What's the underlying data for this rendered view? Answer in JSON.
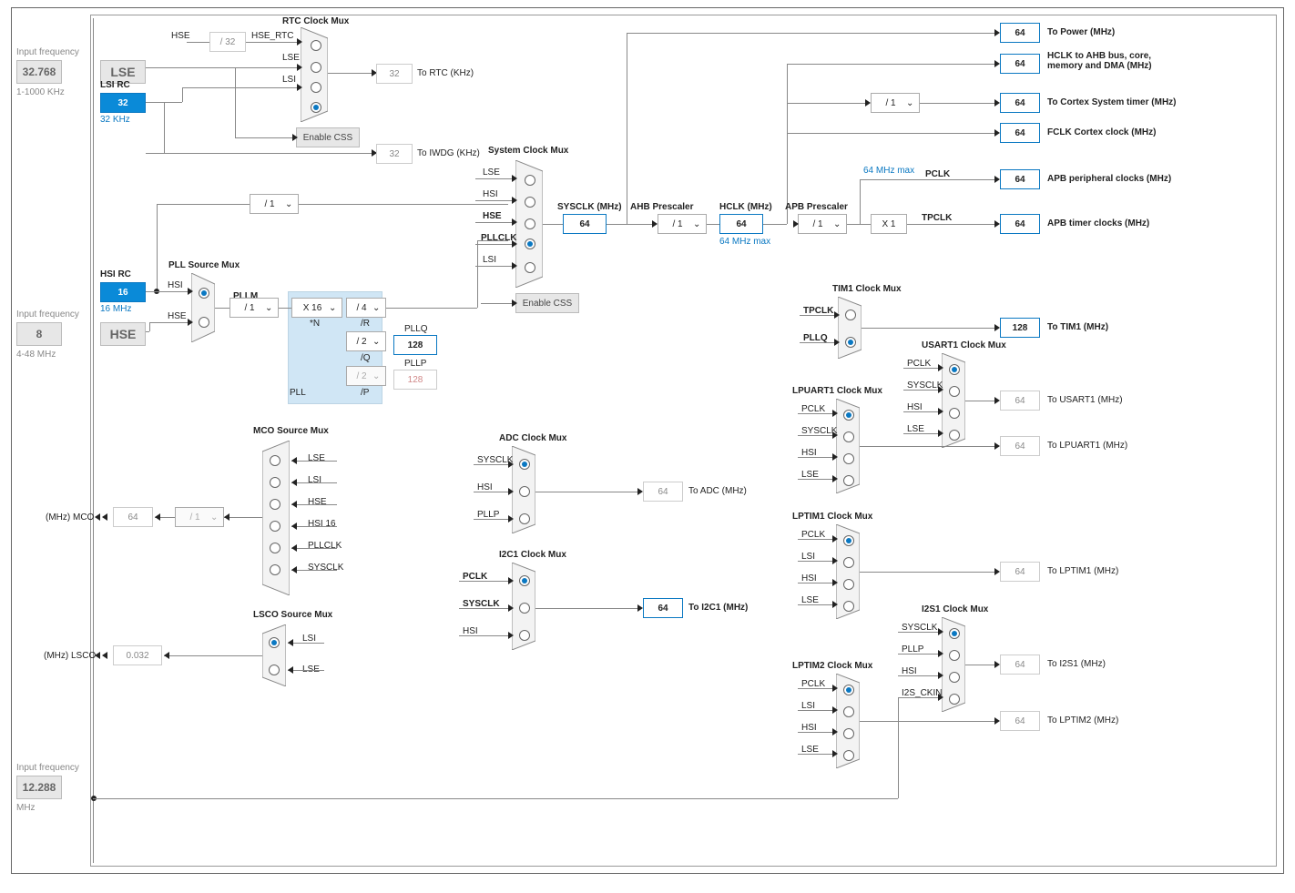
{
  "left": {
    "lse": {
      "label": "Input frequency",
      "val": "32.768",
      "range": "1-1000 KHz"
    },
    "hse": {
      "label": "Input frequency",
      "val": "8",
      "range": "4-48 MHz"
    },
    "i2s": {
      "label": "Input frequency",
      "val": "12.288",
      "unit": "MHz"
    }
  },
  "osc": {
    "lse": {
      "label": "LSE"
    },
    "lsi": {
      "title": "LSI RC",
      "val": "32",
      "unit": "32 KHz"
    },
    "hsi": {
      "title": "HSI RC",
      "val": "16",
      "unit": "16 MHz"
    },
    "hse": {
      "label": "HSE"
    }
  },
  "rtc": {
    "title": "RTC Clock Mux",
    "hse_rtc_label": "HSE_RTC",
    "hse_div": "/ 32",
    "hse": "HSE",
    "lse": "LSE",
    "lsi": "LSI",
    "enable": "Enable CSS",
    "val": "32",
    "out": "To RTC (KHz)"
  },
  "iwdg": {
    "val": "32",
    "out": "To IWDG (KHz)"
  },
  "hsidiv": {
    "val": "/ 1"
  },
  "pllsrc": {
    "title": "PLL Source Mux",
    "hsi": "HSI",
    "hse": "HSE"
  },
  "pll": {
    "pllm": "/ 1",
    "n": "X 16",
    "n_lbl": "*N",
    "r": "/ 4",
    "r_lbl": "/R",
    "q": "/ 2",
    "q_lbl": "/Q",
    "p": "/ 2",
    "p_lbl": "/P",
    "q_out": "128",
    "p_out": "128",
    "pllq": "PLLQ",
    "pllp": "PLLP",
    "pllm_lbl": "PLLM",
    "pll": "PLL"
  },
  "sys": {
    "title": "System Clock Mux",
    "lse": "LSE",
    "hsi": "HSI",
    "hse": "HSE",
    "pllclk": "PLLCLK",
    "lsi": "LSI",
    "enable": "Enable CSS",
    "sysclk": "SYSCLK (MHz)",
    "sysclk_v": "64"
  },
  "ahb": {
    "title": "AHB Prescaler",
    "val": "/ 1",
    "hclk": "HCLK (MHz)",
    "hclk_v": "64",
    "max": "64 MHz max"
  },
  "apb": {
    "title": "APB Prescaler",
    "val": "/ 1",
    "cortexdiv": "/ 1",
    "max": "64 MHz max",
    "pclk": "PCLK",
    "x1": "X 1",
    "tpclk": "TPCLK"
  },
  "outs": {
    "power": {
      "v": "64",
      "l": "To Power (MHz)"
    },
    "ahbbus": {
      "v": "64",
      "l": "HCLK to AHB bus, core, memory and DMA (MHz)"
    },
    "cortex": {
      "v": "64",
      "l": "To Cortex System timer (MHz)"
    },
    "fclk": {
      "v": "64",
      "l": "FCLK Cortex clock (MHz)"
    },
    "apbper": {
      "v": "64",
      "l": "APB peripheral clocks (MHz)"
    },
    "apbtim": {
      "v": "64",
      "l": "APB timer clocks (MHz)"
    }
  },
  "mco": {
    "title": "MCO Source Mux",
    "lse": "LSE",
    "lsi": "LSI",
    "hse": "HSE",
    "hsi16": "HSI 16",
    "pllclk": "PLLCLK",
    "sysclk": "SYSCLK",
    "div": "/ 1",
    "val": "64",
    "out": "(MHz) MCO"
  },
  "lsco": {
    "title": "LSCO Source Mux",
    "lsi": "LSI",
    "lse": "LSE",
    "val": "0.032",
    "out": "(MHz) LSCO"
  },
  "adc": {
    "title": "ADC Clock Mux",
    "sysclk": "SYSCLK",
    "hsi": "HSI",
    "pllp": "PLLP",
    "val": "64",
    "out": "To ADC (MHz)"
  },
  "i2c1": {
    "title": "I2C1 Clock Mux",
    "pclk": "PCLK",
    "sysclk": "SYSCLK",
    "hsi": "HSI",
    "val": "64",
    "out": "To I2C1 (MHz)"
  },
  "tim1": {
    "title": "TIM1 Clock Mux",
    "tpclk": "TPCLK",
    "pllq": "PLLQ",
    "val": "128",
    "out": "To TIM1 (MHz)"
  },
  "usart1": {
    "title": "USART1 Clock Mux",
    "pclk": "PCLK",
    "sysclk": "SYSCLK",
    "hsi": "HSI",
    "lse": "LSE",
    "val": "64",
    "out": "To USART1 (MHz)"
  },
  "lpuart1": {
    "title": "LPUART1 Clock Mux",
    "pclk": "PCLK",
    "sysclk": "SYSCLK",
    "hsi": "HSI",
    "lse": "LSE",
    "val": "64",
    "out": "To LPUART1 (MHz)"
  },
  "lptim1": {
    "title": "LPTIM1 Clock Mux",
    "pclk": "PCLK",
    "lsi": "LSI",
    "hsi": "HSI",
    "lse": "LSE",
    "val": "64",
    "out": "To LPTIM1 (MHz)"
  },
  "lptim2": {
    "title": "LPTIM2 Clock Mux",
    "pclk": "PCLK",
    "lsi": "LSI",
    "hsi": "HSI",
    "lse": "LSE",
    "val": "64",
    "out": "To LPTIM2 (MHz)"
  },
  "i2s1": {
    "title": "I2S1 Clock Mux",
    "sysclk": "SYSCLK",
    "pllp": "PLLP",
    "hsi": "HSI",
    "i2sckin": "I2S_CKIN",
    "val": "64",
    "out": "To I2S1 (MHz)"
  }
}
